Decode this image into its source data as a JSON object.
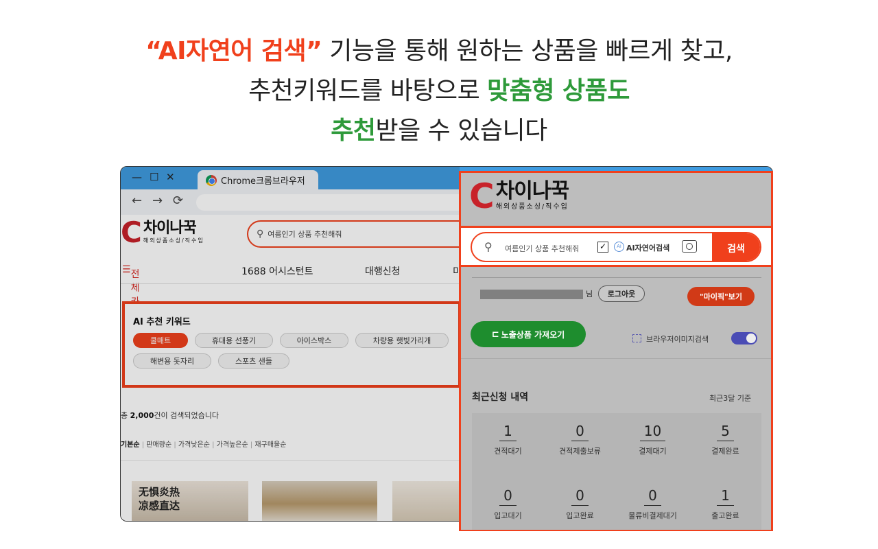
{
  "headline": {
    "line1_red": "“AI자연어 검색”",
    "line1_rest": " 기능을 통해 원하는 상품을 빠르게 찾고,",
    "line2_rest": "추천키워드를 바탕으로 ",
    "line2_green": "맞춤형 상품도",
    "line3_green": "추천",
    "line3_rest": "받을 수 있습니다"
  },
  "browser": {
    "window_controls": [
      "—",
      "☐",
      "✕"
    ],
    "tab_title": "Chrome크롬브라우저",
    "nav": {
      "back": "←",
      "forward": "→",
      "reload": "⟳"
    }
  },
  "logo": {
    "main": "차이나꾹",
    "sub": "해외상품소싱/직수입"
  },
  "site": {
    "search_placeholder": "여름인기 상품 추천해줘",
    "menu": [
      "전체카테고리",
      "1688 어시스턴트",
      "대행신청",
      "미"
    ],
    "rec_title": "AI 추천 키워드",
    "keywords": [
      "쿨매트",
      "휴대용 선풍기",
      "아이스박스",
      "차량용 햇빛가리개",
      "해변용 돗자리",
      "스포츠 샌들"
    ],
    "result_prefix": "총 ",
    "result_count": "2,000",
    "result_suffix": "건이 검색되었습니다",
    "sort_options": [
      "기본순",
      "판매량순",
      "가격낮은순",
      "가격높은순",
      "재구매율순"
    ],
    "product1_text": [
      "无惧炎热",
      "凉感直达"
    ]
  },
  "panel": {
    "search_placeholder": "여름인기 상품 추천해줘",
    "check_mark": "✓",
    "ai_search_label": "AI자연어검색",
    "search_button": "검색",
    "user_suffix": "님",
    "logout_button": "로그아웃",
    "mypick_button": "\"마이픽\"보기",
    "expose_button": "노출상품 가져오기",
    "browser_image_search": "브라우저이미지검색",
    "history_title": "최근신청 내역",
    "history_note": "최근3달 기준",
    "stats": [
      {
        "value": "1",
        "label": "견적대기"
      },
      {
        "value": "0",
        "label": "견적제출보류"
      },
      {
        "value": "10",
        "label": "결제대기"
      },
      {
        "value": "5",
        "label": "결제완료"
      },
      {
        "value": "0",
        "label": "입고대기"
      },
      {
        "value": "0",
        "label": "입고완료"
      },
      {
        "value": "0",
        "label": "물류비결제대기"
      },
      {
        "value": "1",
        "label": "출고완료"
      }
    ]
  },
  "colors": {
    "accent_red": "#f0401c",
    "accent_green": "#2e9a3a",
    "brand_red": "#c8222a",
    "titlebar_blue": "#3f9be0"
  }
}
